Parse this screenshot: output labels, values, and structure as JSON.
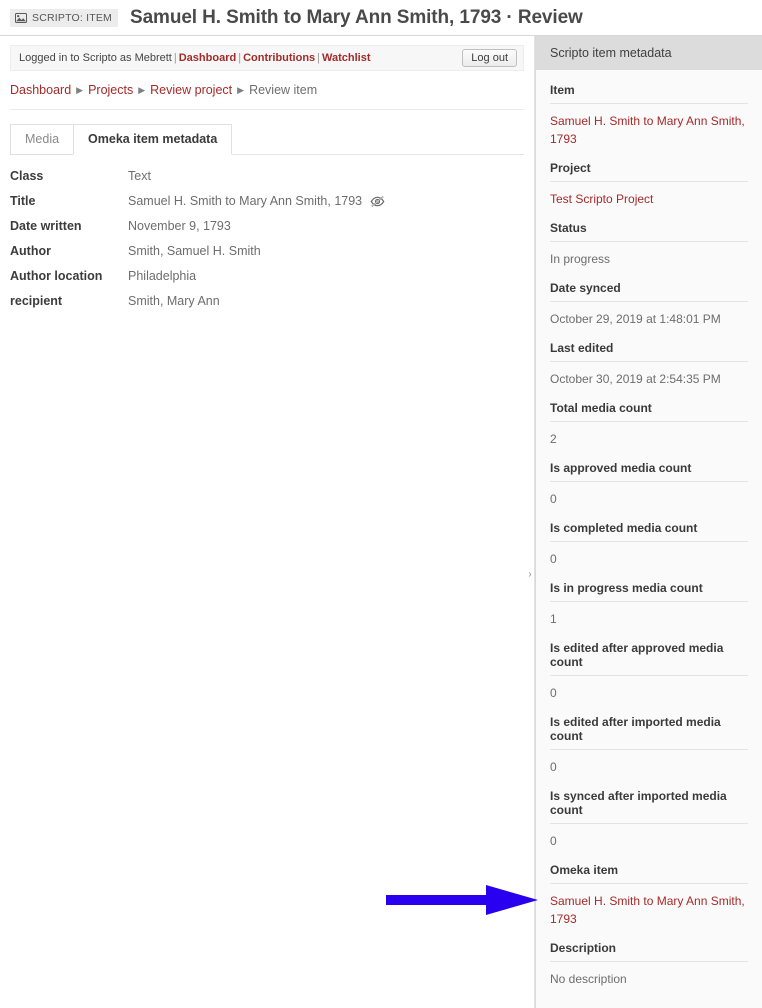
{
  "titlebar": {
    "badge_label": "SCRIPTO: ITEM",
    "badge_icon": "image-icon",
    "title": "Samuel H. Smith to Mary Ann Smith, 1793  ·  Review"
  },
  "userbar": {
    "prefix": "Logged in to Scripto as Mebrett",
    "links": [
      "Dashboard",
      "Contributions",
      "Watchlist"
    ],
    "separator": "|",
    "logout_label": "Log out"
  },
  "breadcrumb": {
    "items": [
      {
        "label": "Dashboard",
        "is_link": true
      },
      {
        "label": "Projects",
        "is_link": true
      },
      {
        "label": "Review project",
        "is_link": true
      },
      {
        "label": "Review item",
        "is_link": false
      }
    ],
    "separator_icon": "caret-right-icon"
  },
  "tabs": [
    {
      "label": "Media",
      "active": false
    },
    {
      "label": "Omeka item metadata",
      "active": true
    }
  ],
  "item_metadata": {
    "rows": [
      {
        "label": "Class",
        "value": "Text",
        "icon": null
      },
      {
        "label": "Title",
        "value": "Samuel H. Smith to Mary Ann Smith, 1793",
        "icon": "eye-slash-icon"
      },
      {
        "label": "Date written",
        "value": "November 9, 1793",
        "icon": null
      },
      {
        "label": "Author",
        "value": "Smith, Samuel H. Smith",
        "icon": null
      },
      {
        "label": "Author location",
        "value": "Philadelphia",
        "icon": null
      },
      {
        "label": "recipient",
        "value": "Smith, Mary Ann",
        "icon": null
      }
    ]
  },
  "panel_handle": {
    "icon": "chevron-right-icon"
  },
  "sidebar": {
    "header": "Scripto item metadata",
    "fields": [
      {
        "label": "Item",
        "value": "Samuel H. Smith to Mary Ann Smith, 1793",
        "is_link": true
      },
      {
        "label": "Project",
        "value": "Test Scripto Project",
        "is_link": true
      },
      {
        "label": "Status",
        "value": "In progress",
        "is_link": false
      },
      {
        "label": "Date synced",
        "value": "October 29, 2019 at 1:48:01 PM",
        "is_link": false
      },
      {
        "label": "Last edited",
        "value": "October 30, 2019 at 2:54:35 PM",
        "is_link": false
      },
      {
        "label": "Total media count",
        "value": "2",
        "is_link": false
      },
      {
        "label": "Is approved media count",
        "value": "0",
        "is_link": false
      },
      {
        "label": "Is completed media count",
        "value": "0",
        "is_link": false
      },
      {
        "label": "Is in progress media count",
        "value": "1",
        "is_link": false
      },
      {
        "label": "Is edited after approved media count",
        "value": "0",
        "is_link": false
      },
      {
        "label": "Is edited after imported media count",
        "value": "0",
        "is_link": false
      },
      {
        "label": "Is synced after imported media count",
        "value": "0",
        "is_link": false
      },
      {
        "label": "Omeka item",
        "value": "Samuel H. Smith to Mary Ann Smith, 1793",
        "is_link": true
      },
      {
        "label": "Description",
        "value": "No description",
        "is_link": false
      }
    ]
  },
  "annotation": {
    "type": "arrow",
    "direction": "right",
    "color": "#2A00F0",
    "points_to": "Omeka item"
  },
  "colors": {
    "link": "#a42a2a",
    "sidebar_bg": "#fafafa",
    "sidebar_header_bg": "#dcdcdc",
    "text": "#3b3b3b",
    "muted": "#6d6d6d",
    "annotation": "#2A00F0"
  }
}
